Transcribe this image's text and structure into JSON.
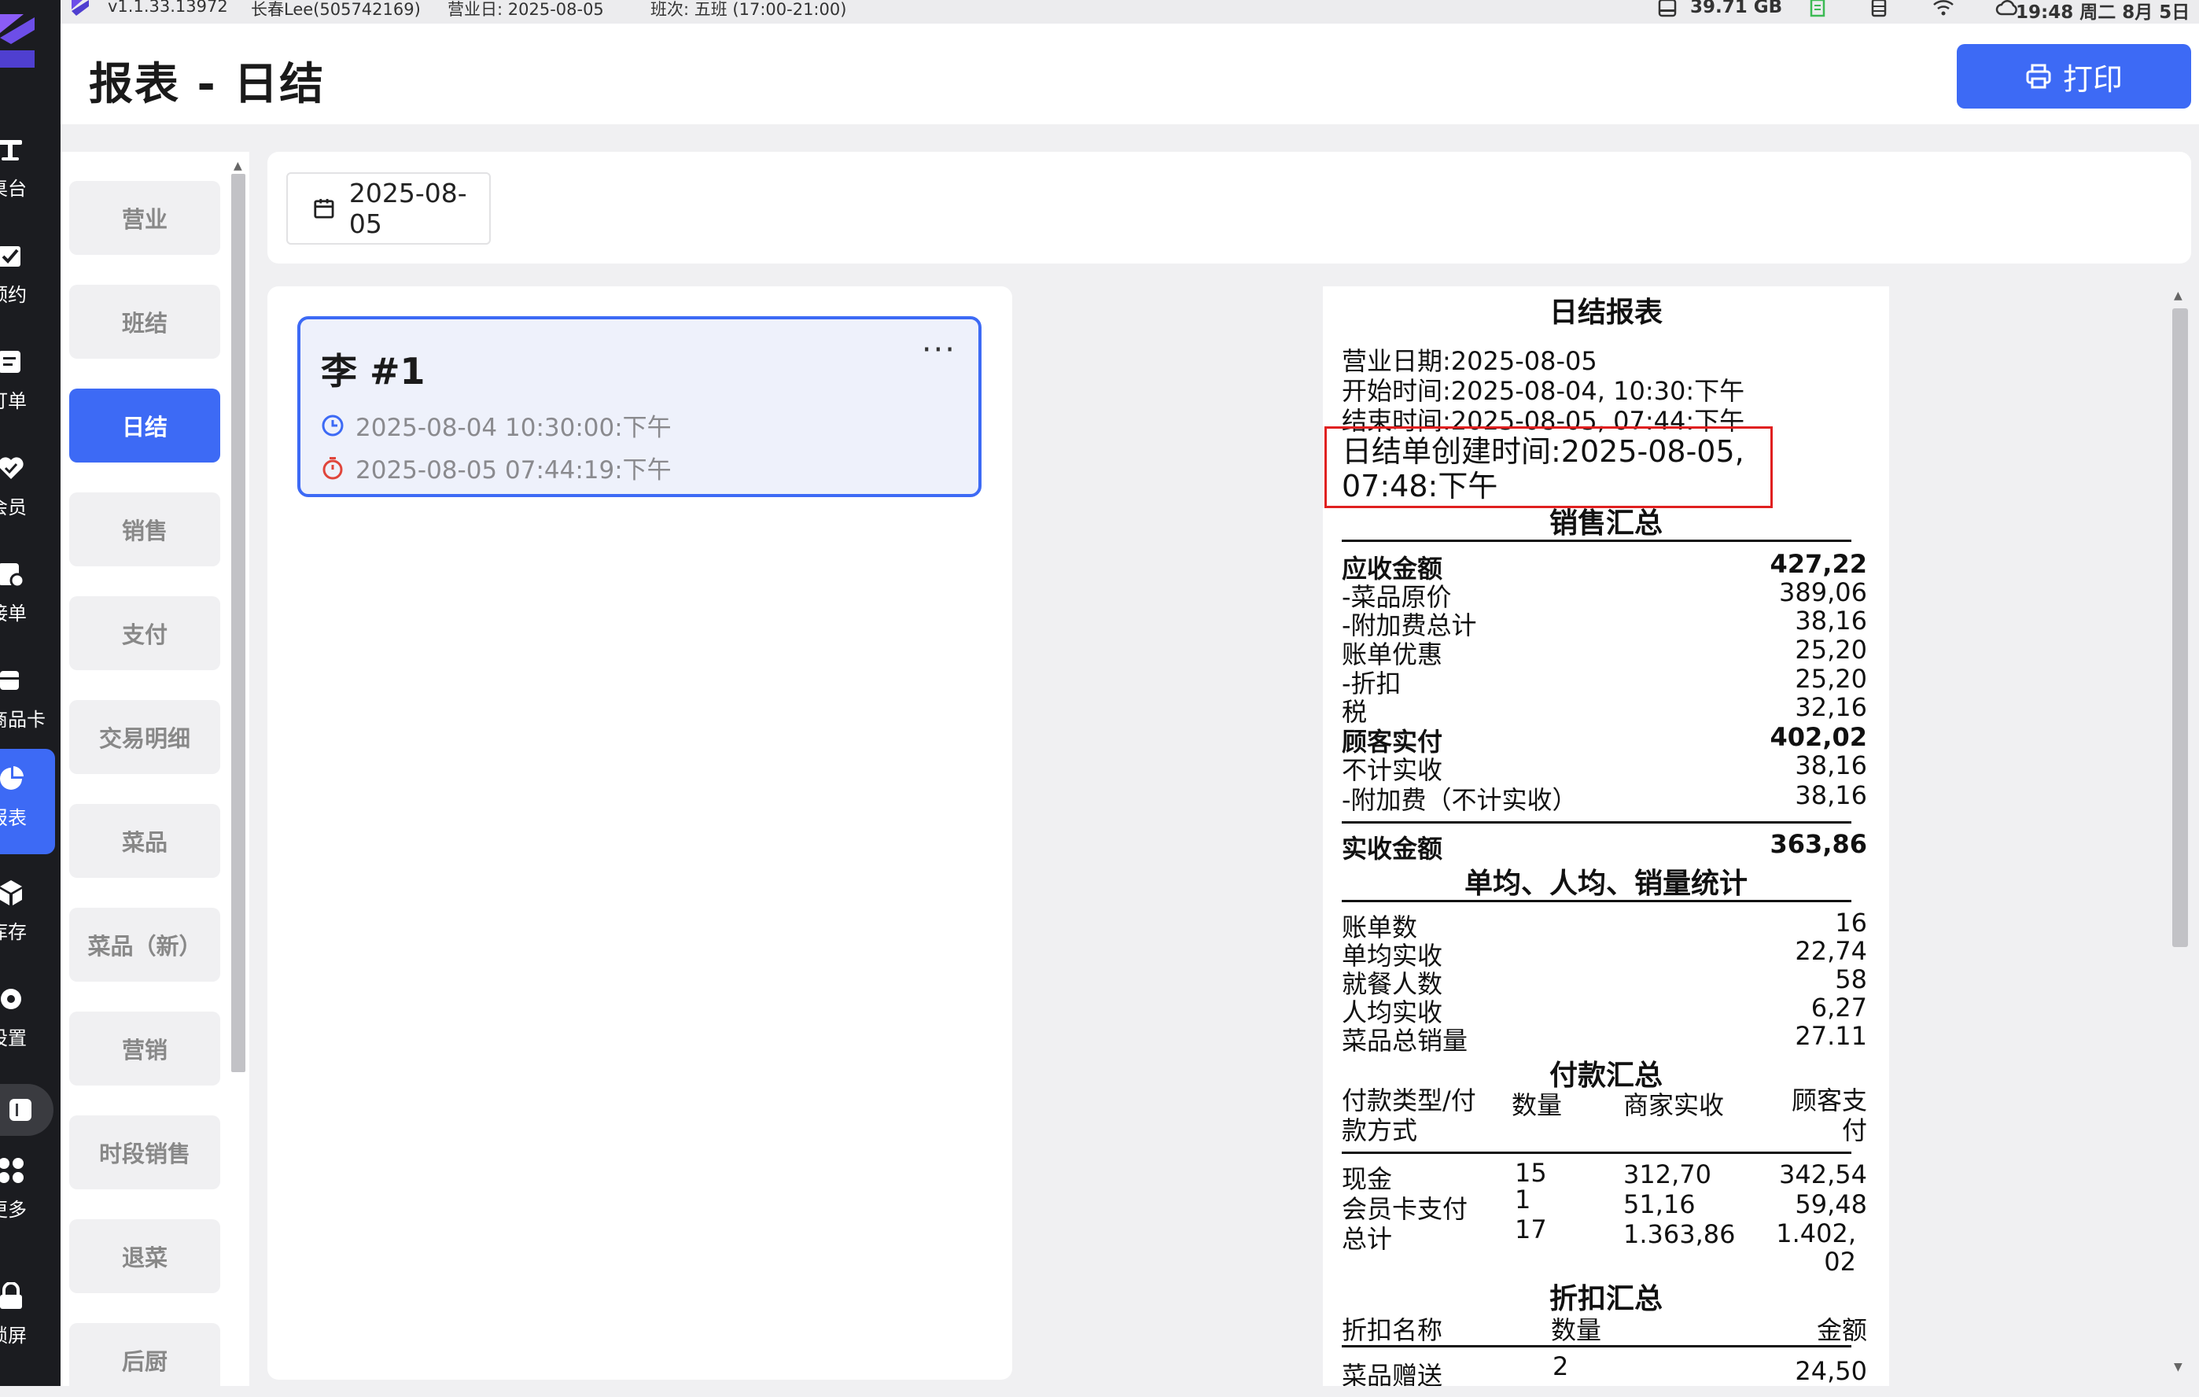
{
  "statusbar": {
    "version": "v1.1.33.13972",
    "user": "长春Lee(505742169)",
    "business_day": "营业日: 2025-08-05",
    "shift": "班次:   五班 (17:00-21:00)",
    "storage": "39.71 GB",
    "clock": "19:48 周二 8月 5日"
  },
  "rail": {
    "items": [
      {
        "label": "桌台",
        "icon": "table-icon"
      },
      {
        "label": "预约",
        "icon": "calendar-check-icon"
      },
      {
        "label": "订单",
        "icon": "order-icon"
      },
      {
        "label": "会员",
        "icon": "heart-icon"
      },
      {
        "label": "接单",
        "icon": "receive-order-icon"
      },
      {
        "label": "商品卡",
        "icon": "product-card-icon"
      },
      {
        "label": "报表",
        "icon": "pie-chart-icon"
      },
      {
        "label": "库存",
        "icon": "box-icon"
      },
      {
        "label": "设置",
        "icon": "gear-icon"
      },
      {
        "label": "更多",
        "icon": "apps-icon"
      },
      {
        "label": "锁屏",
        "icon": "lock-icon"
      }
    ],
    "active_index": 6
  },
  "header": {
    "title": "报表 - 日结",
    "print_label": "打印"
  },
  "nav": {
    "items": [
      "营业",
      "班结",
      "日结",
      "销售",
      "支付",
      "交易明细",
      "菜品",
      "菜品（新）",
      "营销",
      "时段销售",
      "退菜",
      "后厨"
    ],
    "active_index": 2
  },
  "date_filter": {
    "value": "2025-08-05"
  },
  "card": {
    "title": "李 #1",
    "more": "···",
    "start": "2025-08-04 10:30:00:下午",
    "end": "2025-08-05 07:44:19:下午"
  },
  "receipt": {
    "title": "日结报表",
    "business_date": "营业日期:2025-08-05",
    "start_time": "开始时间:2025-08-04, 10:30:下午",
    "end_time": "结束时间:2025-08-05, 07:44:下午",
    "created_line1": "日结单创建时间:2025-08-05,",
    "created_line2": "07:48:下午",
    "sales_title": "销售汇总",
    "sales": [
      {
        "label": "应收金额",
        "value": "427,22",
        "bold": true
      },
      {
        "label": " -菜品原价",
        "value": "389,06"
      },
      {
        "label": " -附加费总计",
        "value": "38,16"
      },
      {
        "label": "账单优惠",
        "value": "25,20"
      },
      {
        "label": " -折扣",
        "value": "25,20"
      },
      {
        "label": "税",
        "value": "32,16"
      },
      {
        "label": "顾客实付",
        "value": "402,02",
        "bold": true
      },
      {
        "label": "不计实收",
        "value": "38,16"
      },
      {
        "label": " -附加费（不计实收）",
        "value": "38,16"
      }
    ],
    "actual_label": "实收金额",
    "actual_value": "363,86",
    "stats_title": "单均、人均、销量统计",
    "stats": [
      {
        "label": "账单数",
        "value": "16"
      },
      {
        "label": "单均实收",
        "value": "22,74"
      },
      {
        "label": "就餐人数",
        "value": "58"
      },
      {
        "label": "人均实收",
        "value": "6,27"
      },
      {
        "label": "菜品总销量",
        "value": "27.11"
      }
    ],
    "payment_title": "付款汇总",
    "payment_headers": [
      "付款类型/付款方式",
      "数量",
      "商家实收",
      "顾客支付"
    ],
    "payment_rows": [
      [
        "现金",
        "15",
        "312,70",
        "342,54"
      ],
      [
        "会员卡支付",
        "1",
        "51,16",
        "59,48"
      ],
      [
        "总计",
        "17",
        "1.363,86",
        "1.402,02"
      ]
    ],
    "discount_title": "折扣汇总",
    "discount_headers": [
      "折扣名称",
      "数量",
      "金额"
    ],
    "discount_rows": [
      [
        "菜品赠送",
        "2",
        "24,50"
      ]
    ]
  }
}
